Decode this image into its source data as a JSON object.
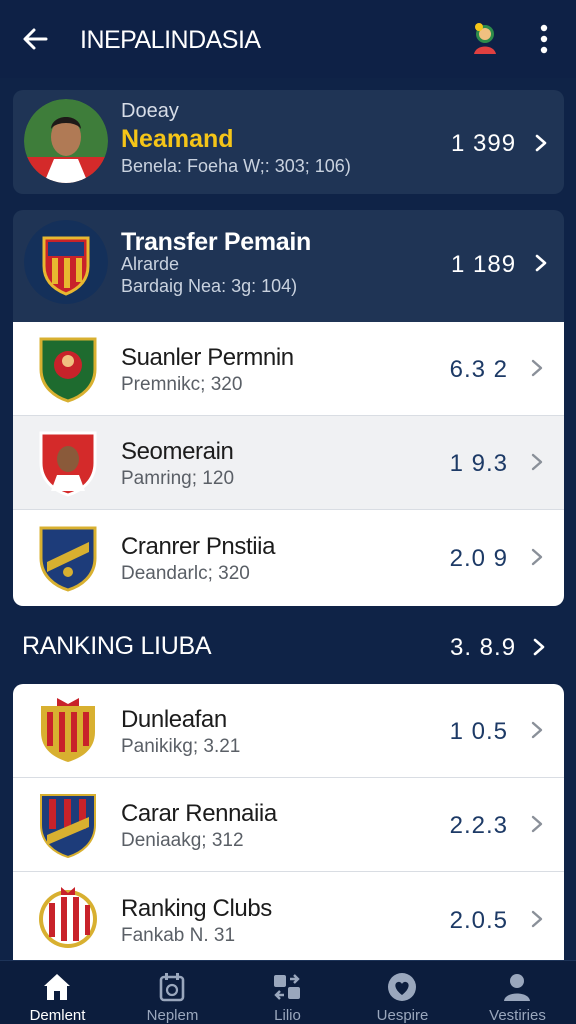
{
  "header": {
    "title": "INEPALINDASIA",
    "back_icon": "arrow-left-icon",
    "profile_icon": "avatar-icon",
    "menu_icon": "more-vertical-icon"
  },
  "featured": [
    {
      "label": "Doeay",
      "name": "Neamand",
      "meta": "Benela: Foeha W;: 303; 106)",
      "value": "1 399"
    },
    {
      "name": "Transfer Pemain",
      "label": "Alrarde",
      "meta": "Bardaig Nea: 3g: 104)",
      "value": "1 189"
    }
  ],
  "list1": [
    {
      "title": "Suanler Permnin",
      "sub": "Premnikc; 320",
      "value": "6.3 2"
    },
    {
      "title": "Seomerain",
      "sub": "Pamring; 120",
      "value": "1 9.3"
    },
    {
      "title": "Cranrer Pnstiia",
      "sub": "Deandarlc; 320",
      "value": "2.0 9"
    }
  ],
  "section": {
    "title": "RANKING LIUBA",
    "value": "3. 8.9"
  },
  "list2": [
    {
      "title": "Dunleafan",
      "sub": "Panikikg; 3.21",
      "value": "1 0.5"
    },
    {
      "title": "Carar Rennaiia",
      "sub": "Deniaakg; 312",
      "value": "2.2.3"
    },
    {
      "title": "Ranking Clubs",
      "sub": "Fankab N. 31",
      "value": "2.0.5"
    }
  ],
  "nav": [
    {
      "label": "Demlent",
      "icon": "home-icon",
      "active": true
    },
    {
      "label": "Neplem",
      "icon": "calendar-icon",
      "active": false
    },
    {
      "label": "Lilio",
      "icon": "transfer-icon",
      "active": false
    },
    {
      "label": "Uespire",
      "icon": "heart-icon",
      "active": false
    },
    {
      "label": "Vestiries",
      "icon": "user-icon",
      "active": false
    }
  ],
  "colors": {
    "background": "#0f2347",
    "card_dark": "#1f3455",
    "accent_gold": "#f5c518",
    "value_blue": "#1d3a66"
  }
}
